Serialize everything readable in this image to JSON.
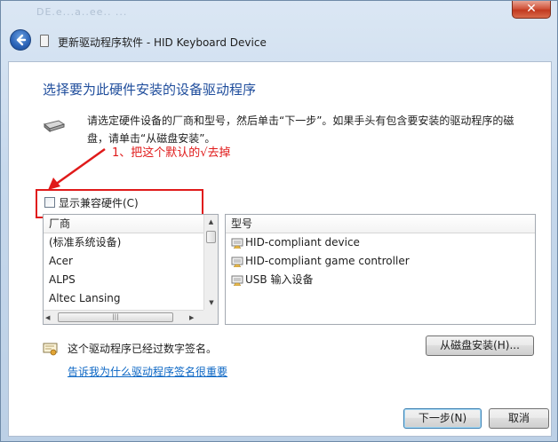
{
  "window": {
    "ghost_title": "DE.e...a..ee.. ...",
    "close_glyph": "✕",
    "title": "更新驱动程序软件 - HID Keyboard Device"
  },
  "main": {
    "heading": "选择要为此硬件安装的设备驱动程序",
    "instructions": "请选定硬件设备的厂商和型号，然后单击“下一步”。如果手头有包含要安装的驱动程序的磁盘，请单击“从磁盘安装”。",
    "annotation": "1、把这个默认的√去掉",
    "show_compatible": {
      "label": "显示兼容硬件(C)",
      "checked": false
    },
    "manufacturer_list": {
      "header": "厂商",
      "items": [
        "(标准系统设备)",
        "Acer",
        "ALPS",
        "Altec Lansing"
      ]
    },
    "model_list": {
      "header": "型号",
      "items": [
        "HID-compliant device",
        "HID-compliant game controller",
        "USB 输入设备"
      ]
    },
    "signature_text": "这个驱动程序已经过数字签名。",
    "signature_link": "告诉我为什么驱动程序签名很重要",
    "have_disk_button": "从磁盘安装(H)...",
    "next_button": "下一步(N)",
    "cancel_button": "取消"
  },
  "colors": {
    "heading": "#1f4d9c",
    "annotation": "#e01a1a",
    "link": "#0b66c4"
  },
  "icons": [
    "back-arrow-icon",
    "wizard-icon",
    "hardware-icon",
    "certificate-icon",
    "device-driver-icon"
  ]
}
